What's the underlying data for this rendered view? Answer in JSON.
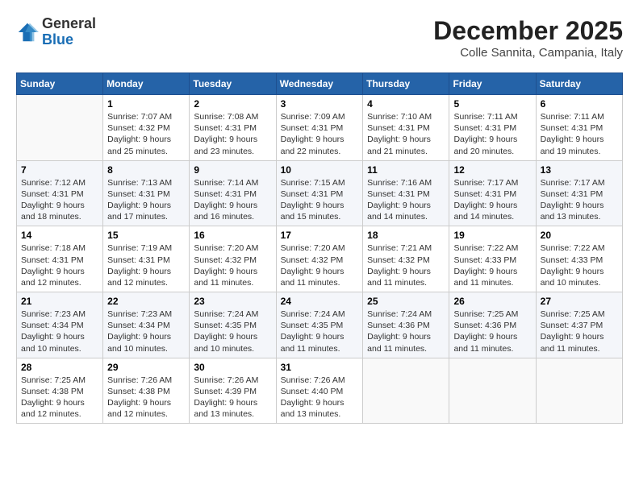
{
  "header": {
    "logo_general": "General",
    "logo_blue": "Blue",
    "month_title": "December 2025",
    "subtitle": "Colle Sannita, Campania, Italy"
  },
  "calendar": {
    "days_of_week": [
      "Sunday",
      "Monday",
      "Tuesday",
      "Wednesday",
      "Thursday",
      "Friday",
      "Saturday"
    ],
    "weeks": [
      [
        {
          "day": "",
          "info": ""
        },
        {
          "day": "1",
          "info": "Sunrise: 7:07 AM\nSunset: 4:32 PM\nDaylight: 9 hours\nand 25 minutes."
        },
        {
          "day": "2",
          "info": "Sunrise: 7:08 AM\nSunset: 4:31 PM\nDaylight: 9 hours\nand 23 minutes."
        },
        {
          "day": "3",
          "info": "Sunrise: 7:09 AM\nSunset: 4:31 PM\nDaylight: 9 hours\nand 22 minutes."
        },
        {
          "day": "4",
          "info": "Sunrise: 7:10 AM\nSunset: 4:31 PM\nDaylight: 9 hours\nand 21 minutes."
        },
        {
          "day": "5",
          "info": "Sunrise: 7:11 AM\nSunset: 4:31 PM\nDaylight: 9 hours\nand 20 minutes."
        },
        {
          "day": "6",
          "info": "Sunrise: 7:11 AM\nSunset: 4:31 PM\nDaylight: 9 hours\nand 19 minutes."
        }
      ],
      [
        {
          "day": "7",
          "info": "Sunrise: 7:12 AM\nSunset: 4:31 PM\nDaylight: 9 hours\nand 18 minutes."
        },
        {
          "day": "8",
          "info": "Sunrise: 7:13 AM\nSunset: 4:31 PM\nDaylight: 9 hours\nand 17 minutes."
        },
        {
          "day": "9",
          "info": "Sunrise: 7:14 AM\nSunset: 4:31 PM\nDaylight: 9 hours\nand 16 minutes."
        },
        {
          "day": "10",
          "info": "Sunrise: 7:15 AM\nSunset: 4:31 PM\nDaylight: 9 hours\nand 15 minutes."
        },
        {
          "day": "11",
          "info": "Sunrise: 7:16 AM\nSunset: 4:31 PM\nDaylight: 9 hours\nand 14 minutes."
        },
        {
          "day": "12",
          "info": "Sunrise: 7:17 AM\nSunset: 4:31 PM\nDaylight: 9 hours\nand 14 minutes."
        },
        {
          "day": "13",
          "info": "Sunrise: 7:17 AM\nSunset: 4:31 PM\nDaylight: 9 hours\nand 13 minutes."
        }
      ],
      [
        {
          "day": "14",
          "info": "Sunrise: 7:18 AM\nSunset: 4:31 PM\nDaylight: 9 hours\nand 12 minutes."
        },
        {
          "day": "15",
          "info": "Sunrise: 7:19 AM\nSunset: 4:31 PM\nDaylight: 9 hours\nand 12 minutes."
        },
        {
          "day": "16",
          "info": "Sunrise: 7:20 AM\nSunset: 4:32 PM\nDaylight: 9 hours\nand 11 minutes."
        },
        {
          "day": "17",
          "info": "Sunrise: 7:20 AM\nSunset: 4:32 PM\nDaylight: 9 hours\nand 11 minutes."
        },
        {
          "day": "18",
          "info": "Sunrise: 7:21 AM\nSunset: 4:32 PM\nDaylight: 9 hours\nand 11 minutes."
        },
        {
          "day": "19",
          "info": "Sunrise: 7:22 AM\nSunset: 4:33 PM\nDaylight: 9 hours\nand 11 minutes."
        },
        {
          "day": "20",
          "info": "Sunrise: 7:22 AM\nSunset: 4:33 PM\nDaylight: 9 hours\nand 10 minutes."
        }
      ],
      [
        {
          "day": "21",
          "info": "Sunrise: 7:23 AM\nSunset: 4:34 PM\nDaylight: 9 hours\nand 10 minutes."
        },
        {
          "day": "22",
          "info": "Sunrise: 7:23 AM\nSunset: 4:34 PM\nDaylight: 9 hours\nand 10 minutes."
        },
        {
          "day": "23",
          "info": "Sunrise: 7:24 AM\nSunset: 4:35 PM\nDaylight: 9 hours\nand 10 minutes."
        },
        {
          "day": "24",
          "info": "Sunrise: 7:24 AM\nSunset: 4:35 PM\nDaylight: 9 hours\nand 11 minutes."
        },
        {
          "day": "25",
          "info": "Sunrise: 7:24 AM\nSunset: 4:36 PM\nDaylight: 9 hours\nand 11 minutes."
        },
        {
          "day": "26",
          "info": "Sunrise: 7:25 AM\nSunset: 4:36 PM\nDaylight: 9 hours\nand 11 minutes."
        },
        {
          "day": "27",
          "info": "Sunrise: 7:25 AM\nSunset: 4:37 PM\nDaylight: 9 hours\nand 11 minutes."
        }
      ],
      [
        {
          "day": "28",
          "info": "Sunrise: 7:25 AM\nSunset: 4:38 PM\nDaylight: 9 hours\nand 12 minutes."
        },
        {
          "day": "29",
          "info": "Sunrise: 7:26 AM\nSunset: 4:38 PM\nDaylight: 9 hours\nand 12 minutes."
        },
        {
          "day": "30",
          "info": "Sunrise: 7:26 AM\nSunset: 4:39 PM\nDaylight: 9 hours\nand 13 minutes."
        },
        {
          "day": "31",
          "info": "Sunrise: 7:26 AM\nSunset: 4:40 PM\nDaylight: 9 hours\nand 13 minutes."
        },
        {
          "day": "",
          "info": ""
        },
        {
          "day": "",
          "info": ""
        },
        {
          "day": "",
          "info": ""
        }
      ]
    ]
  }
}
